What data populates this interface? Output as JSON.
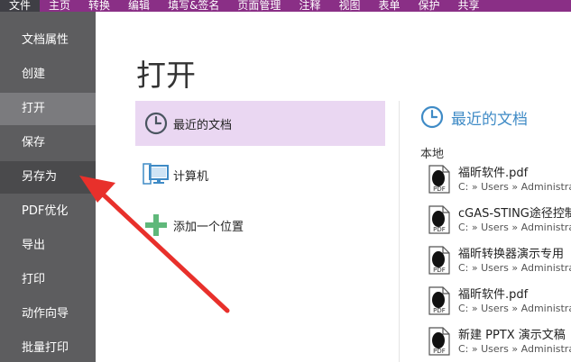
{
  "ribbon": {
    "tabs": [
      "文件",
      "主页",
      "转换",
      "编辑",
      "填写&签名",
      "页面管理",
      "注释",
      "视图",
      "表单",
      "保护",
      "共享"
    ]
  },
  "sidebar": {
    "items": [
      "文档属性",
      "创建",
      "打开",
      "保存",
      "另存为",
      "PDF优化",
      "导出",
      "打印",
      "动作向导",
      "批量打印"
    ]
  },
  "main": {
    "title": "打开",
    "locations": [
      "最近的文档",
      "计算机",
      "添加一个位置"
    ]
  },
  "recent": {
    "title": "最近的文档",
    "section_label": "本地",
    "files": [
      {
        "name": "福昕软件.pdf",
        "path": "C: » Users » Administrat"
      },
      {
        "name": "cGAS-STING途径控制",
        "path": "C: » Users » Administrat"
      },
      {
        "name": "福昕转换器演示专用",
        "path": "C: » Users » Administrat"
      },
      {
        "name": "福昕软件.pdf",
        "path": "C: » Users » Administrat"
      },
      {
        "name": "新建 PPTX 演示文稿",
        "path": "C: » Users » Administrat"
      }
    ]
  },
  "icons": {
    "file_badge": "PDF",
    "colors": {
      "ribbon": "#8a2f86",
      "sidebar": "#5d5d5f",
      "accent": "#3f8bc6",
      "selected": "#ead7f2",
      "plus": "#5fb87a",
      "arrow": "#e8302b"
    }
  }
}
